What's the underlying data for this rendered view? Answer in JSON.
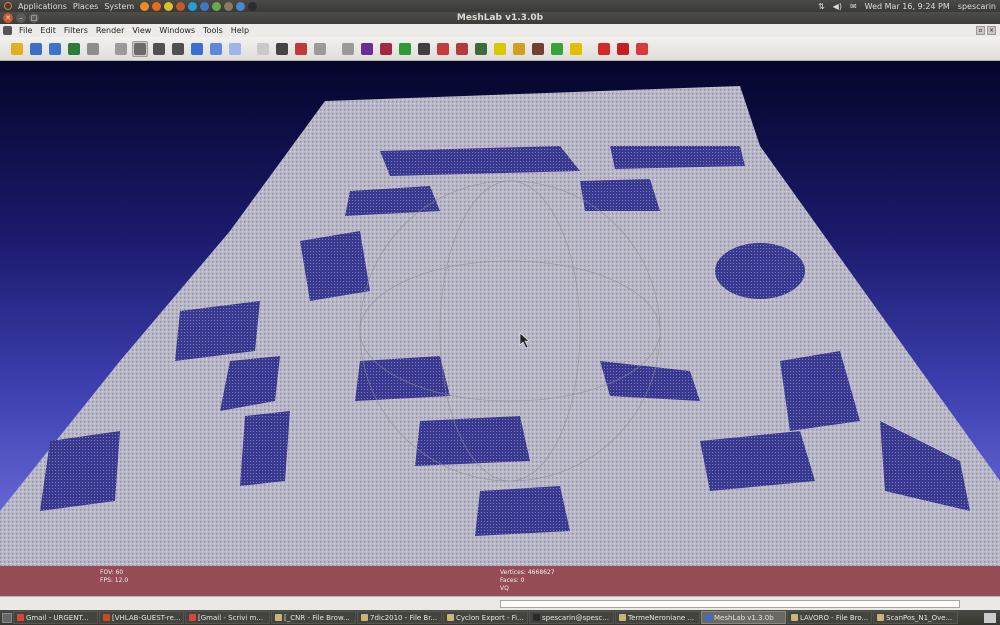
{
  "top_panel": {
    "menus": [
      "Applications",
      "Places",
      "System"
    ],
    "launchers": [
      {
        "icon": "vlc-icon",
        "color": "#f08a24"
      },
      {
        "icon": "firefox-icon",
        "color": "#e46c1b"
      },
      {
        "icon": "chrome-icon",
        "color": "#d9c223"
      },
      {
        "icon": "browser-icon",
        "color": "#c45a2a"
      },
      {
        "icon": "skype-icon",
        "color": "#1fa0db"
      },
      {
        "icon": "help-icon",
        "color": "#3f77c4"
      },
      {
        "icon": "qgis-icon",
        "color": "#6aa84f"
      },
      {
        "icon": "gimp-icon",
        "color": "#8c7a5c"
      },
      {
        "icon": "chromium-icon",
        "color": "#4a88d0"
      },
      {
        "icon": "terminal-icon",
        "color": "#2b2b2b"
      }
    ],
    "datetime": "Wed Mar 16,  9:24 PM",
    "user": "spescarin"
  },
  "window": {
    "title": "MeshLab v1.3.0b"
  },
  "menubar": {
    "items": [
      "File",
      "Edit",
      "Filters",
      "Render",
      "View",
      "Windows",
      "Tools",
      "Help"
    ]
  },
  "toolbar": {
    "groups": [
      [
        {
          "icon": "open-folder-icon",
          "color": "#e0b020",
          "active": false
        },
        {
          "icon": "reload-icon",
          "color": "#3b6fc2",
          "active": false
        },
        {
          "icon": "save-snapshot-icon",
          "color": "#3d74c9",
          "active": false
        },
        {
          "icon": "image-icon",
          "color": "#2c7d3a",
          "active": false
        },
        {
          "icon": "layers-icon",
          "color": "#8d8d8d",
          "active": false
        }
      ],
      [
        {
          "icon": "bbox-icon",
          "color": "#9a9a9a",
          "active": false
        },
        {
          "icon": "points-icon",
          "color": "#6a6a6a",
          "active": true
        },
        {
          "icon": "wireframe-icon",
          "color": "#505050",
          "active": false
        },
        {
          "icon": "hidden-lines-icon",
          "color": "#4f4f4f",
          "active": false
        },
        {
          "icon": "flat-lines-icon",
          "color": "#3c6ecf",
          "active": false
        },
        {
          "icon": "flat-icon",
          "color": "#5d89db",
          "active": false
        },
        {
          "icon": "smooth-icon",
          "color": "#9bb7ea",
          "active": false
        }
      ],
      [
        {
          "icon": "light-icon",
          "color": "#c9c9c9",
          "active": false
        },
        {
          "icon": "bulb-icon",
          "color": "#444444",
          "active": false
        },
        {
          "icon": "backface-icon",
          "color": "#c03a3a",
          "active": false
        },
        {
          "icon": "cull-icon",
          "color": "#9a9a9a",
          "active": false
        }
      ],
      [
        {
          "icon": "select-icon",
          "color": "#9a9a9a",
          "active": false
        },
        {
          "icon": "shield-icon",
          "color": "#6b2e98",
          "active": false
        },
        {
          "icon": "color-texture-icon",
          "color": "#a02a44",
          "active": false
        },
        {
          "icon": "paint-icon",
          "color": "#2d9a35",
          "active": false
        },
        {
          "icon": "measure-icon",
          "color": "#3f3f3f",
          "active": false
        },
        {
          "icon": "select-faces-icon",
          "color": "#c23c3c",
          "active": false
        },
        {
          "icon": "select-vertices-icon",
          "color": "#b23c3c",
          "active": false
        },
        {
          "icon": "raster-icon",
          "color": "#3b6b3b",
          "active": false
        },
        {
          "icon": "annotation-a-icon",
          "color": "#d8c800",
          "active": false
        },
        {
          "icon": "brush-icon",
          "color": "#d0a020",
          "active": false
        },
        {
          "icon": "knife-icon",
          "color": "#704030",
          "active": false
        },
        {
          "icon": "align-icon",
          "color": "#3aa23a",
          "active": false
        },
        {
          "icon": "info-icon",
          "color": "#e0c000",
          "active": false
        }
      ],
      [
        {
          "icon": "delete-faces-icon",
          "color": "#d02a2a",
          "active": false
        },
        {
          "icon": "delete-vertices-icon",
          "color": "#c42020",
          "active": false
        },
        {
          "icon": "delete-all-icon",
          "color": "#d83a3a",
          "active": false
        }
      ]
    ]
  },
  "infobar": {
    "fov": "FOV: 60",
    "fps": "FPS:   12.0",
    "vertices": "Vertices: 4668627",
    "faces": "Faces: 0",
    "vq": "VQ"
  },
  "progress": {
    "value": 0.0
  },
  "taskbar": {
    "items": [
      {
        "label": "Gmail - URGENT...",
        "icon_color": "#d8453a",
        "active": false
      },
      {
        "label": "[VHLAB-GUEST-re...",
        "icon_color": "#c84a20",
        "active": false
      },
      {
        "label": "[Gmail - Scrivi m...",
        "icon_color": "#d8453a",
        "active": false
      },
      {
        "label": "[_CNR - File Brow...",
        "icon_color": "#c9b47a",
        "active": false
      },
      {
        "label": "7dic2010 - File Br...",
        "icon_color": "#c9b47a",
        "active": false
      },
      {
        "label": "Cyclon Export - Fi...",
        "icon_color": "#c9b47a",
        "active": false
      },
      {
        "label": "spescarin@spesc...",
        "icon_color": "#2b2b2b",
        "active": false
      },
      {
        "label": "TermeNeroniane ...",
        "icon_color": "#c9b47a",
        "active": false
      },
      {
        "label": "MeshLab v1.3.0b",
        "icon_color": "#3b6fc2",
        "active": true
      },
      {
        "label": "LAVORO - File Bro...",
        "icon_color": "#c9b47a",
        "active": false
      },
      {
        "label": "ScanPos_N1_Ove...",
        "icon_color": "#c9b47a",
        "active": false
      }
    ]
  }
}
